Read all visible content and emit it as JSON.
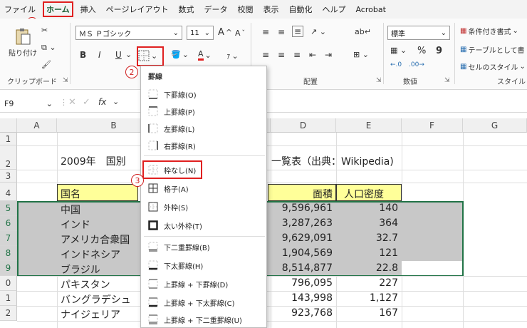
{
  "menubar": {
    "items": [
      "ファイル",
      "ホーム",
      "挿入",
      "ページレイアウト",
      "数式",
      "データ",
      "校閲",
      "表示",
      "自動化",
      "ヘルプ",
      "Acrobat"
    ]
  },
  "ribbon": {
    "clipboard": {
      "paste_label": "貼り付け",
      "group_label": "クリップボード"
    },
    "font": {
      "font_name": "ＭＳ Ｐゴシック",
      "font_size": "11",
      "bold": "B",
      "italic": "I",
      "underline": "U",
      "grow": "A",
      "shrink": "A"
    },
    "alignment": {
      "group_label": "配置"
    },
    "number": {
      "format": "標準",
      "group_label": "数値",
      "percent": "%",
      "comma": "9"
    },
    "styles": {
      "conditional": "条件付き書式",
      "table": "テーブルとして書",
      "cell_style": "セルのスタイル",
      "group_label": "スタイル"
    }
  },
  "annotations": {
    "one": "1",
    "two": "2",
    "three": "3"
  },
  "formula": {
    "cell_ref": "F9",
    "fx": "fx"
  },
  "columns": [
    "A",
    "B",
    "C",
    "D",
    "E",
    "F",
    "G"
  ],
  "rows": [
    "1",
    "2",
    "3",
    "4",
    "5",
    "6",
    "7",
    "8",
    "9",
    "0",
    "1",
    "2"
  ],
  "sheet": {
    "title_left": "2009年　国別",
    "title_right": "一覧表（出典：Wikipedia)",
    "header_name": "国名",
    "header_area": "面積",
    "header_density": "人口密度",
    "data_rows": [
      {
        "name": "中国",
        "area": "9,596,961",
        "density": "140"
      },
      {
        "name": "インド",
        "area": "3,287,263",
        "density": "364"
      },
      {
        "name": "アメリカ合衆国",
        "area": "9,629,091",
        "density": "32.7"
      },
      {
        "name": "インドネシア",
        "area": "1,904,569",
        "density": "121"
      },
      {
        "name": "ブラジル",
        "area": "8,514,877",
        "density": "22.8"
      },
      {
        "name": "パキスタン",
        "area": "796,095",
        "density": "227"
      },
      {
        "name": "バングラデシュ",
        "area": "143,998",
        "density": "1,127"
      },
      {
        "name": "ナイジェリア",
        "area": "923,768",
        "density": "167"
      }
    ]
  },
  "border_menu": {
    "title": "罫線",
    "items": [
      "下罫線(O)",
      "上罫線(P)",
      "左罫線(L)",
      "右罫線(R)",
      "枠なし(N)",
      "格子(A)",
      "外枠(S)",
      "太い外枠(T)",
      "下二重罫線(B)",
      "下太罫線(H)",
      "上罫線 + 下罫線(D)",
      "上罫線 + 下太罫線(C)",
      "上罫線 + 下二重罫線(U)"
    ]
  },
  "colors": {
    "accent_red": "#e02020",
    "selection_gray": "#c8c8c8",
    "header_yellow": "#ffff99",
    "excel_green": "#217346"
  }
}
